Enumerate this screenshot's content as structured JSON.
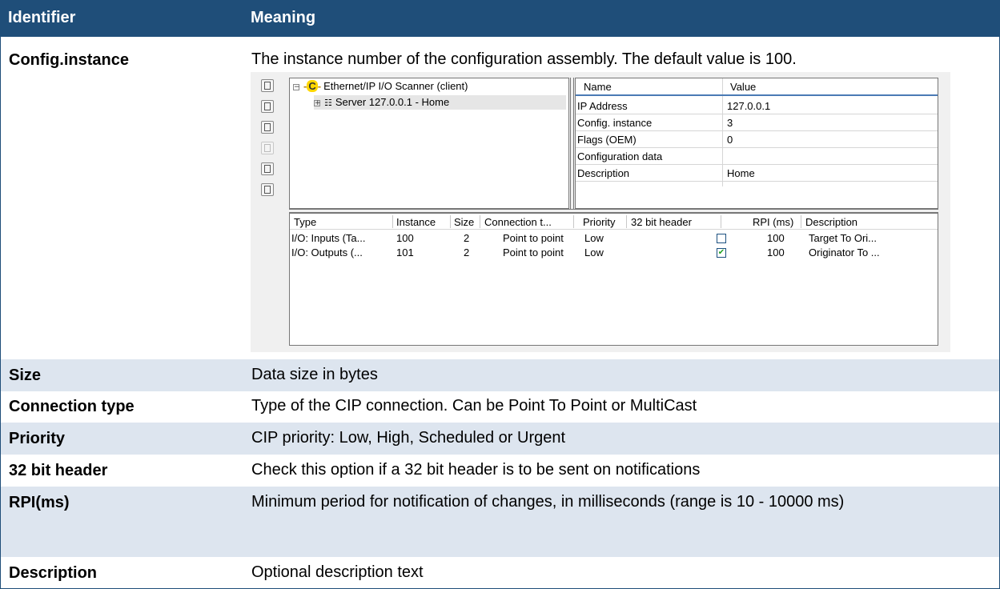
{
  "table": {
    "headers": {
      "identifier": "Identifier",
      "meaning": "Meaning"
    },
    "rows": [
      {
        "id": "Config.instance",
        "meaning": "The instance number of the configuration assembly. The default value is 100."
      },
      {
        "id": "Size",
        "meaning": "Data size in bytes"
      },
      {
        "id": "Connection type",
        "meaning": "Type of the CIP connection. Can be Point To Point or MultiCast"
      },
      {
        "id": "Priority",
        "meaning": "CIP priority: Low, High, Scheduled or Urgent"
      },
      {
        "id": "32 bit header",
        "meaning": "Check this option if a 32 bit header is to be sent on notifications"
      },
      {
        "id": "RPI(ms)",
        "meaning": "Minimum period for notification of changes, in milliseconds (range is 10 - 10000 ms)"
      },
      {
        "id": "Description",
        "meaning": "Optional description text"
      }
    ]
  },
  "screenshot": {
    "tree": {
      "root": "Ethernet/IP I/O Scanner (client)",
      "root_icon_letter": "C",
      "child": "Server 127.0.0.1 - Home"
    },
    "properties": {
      "headers": [
        "Name",
        "Value"
      ],
      "rows": [
        {
          "name": "IP Address",
          "value": "127.0.0.1"
        },
        {
          "name": "Config. instance",
          "value": "3"
        },
        {
          "name": "Flags (OEM)",
          "value": "0"
        },
        {
          "name": "Configuration data",
          "value": ""
        },
        {
          "name": "Description",
          "value": "Home"
        }
      ]
    },
    "connections": {
      "headers": [
        "Type",
        "Instance",
        "Size",
        "Connection t...",
        "Priority",
        "32 bit header",
        "RPI (ms)",
        "Description"
      ],
      "rows": [
        {
          "type": "I/O: Inputs (Ta...",
          "instance": "100",
          "size": "2",
          "connection": "Point to point",
          "priority": "Low",
          "header32": false,
          "rpi": "100",
          "description": "Target To Ori..."
        },
        {
          "type": "I/O: Outputs (...",
          "instance": "101",
          "size": "2",
          "connection": "Point to point",
          "priority": "Low",
          "header32": true,
          "rpi": "100",
          "description": "Originator To ..."
        }
      ]
    }
  },
  "colors": {
    "header_bg": "#1f4e79",
    "alt_row_bg": "#dde5ef",
    "check_green": "#21a121"
  }
}
